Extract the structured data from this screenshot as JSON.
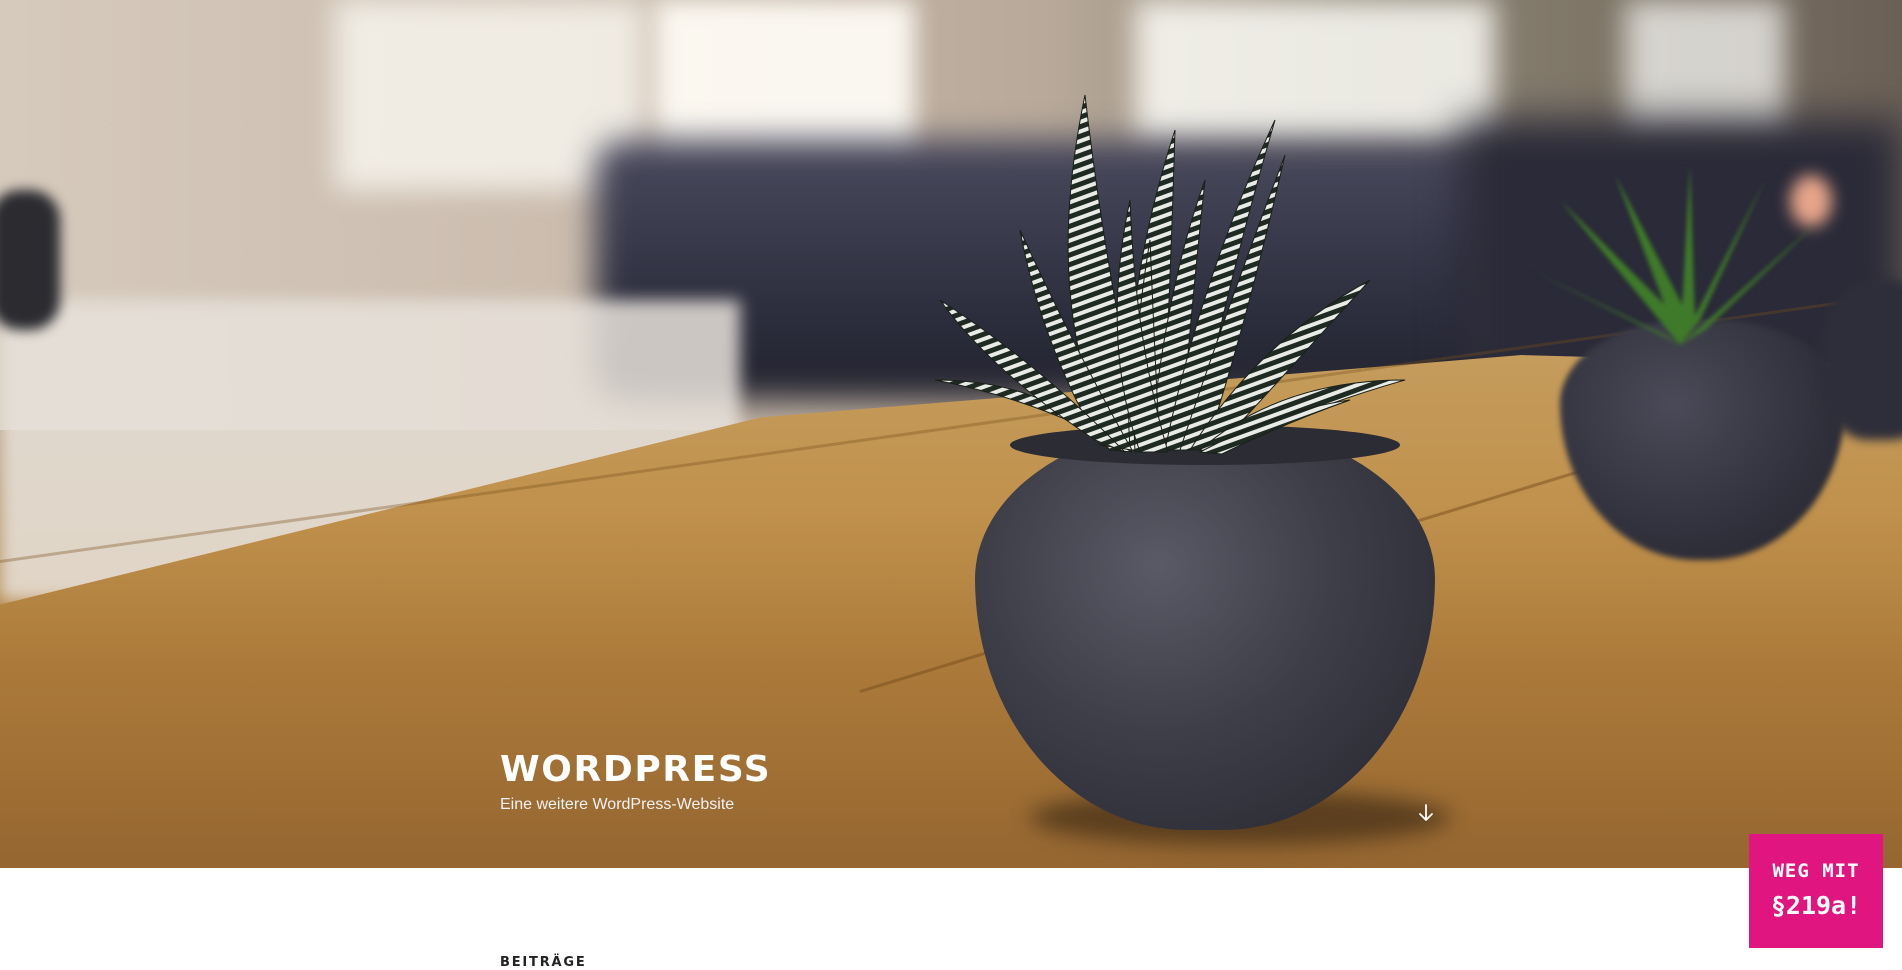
{
  "site": {
    "title": "WORDPRESS",
    "description": "Eine weitere WordPress-Website"
  },
  "hero": {
    "scroll_icon": "arrow-down-icon"
  },
  "content": {
    "section_title": "BEITRÄGE"
  },
  "badge": {
    "line1": "WEG MIT",
    "line2": "§219a!",
    "color": "#e0157f"
  }
}
